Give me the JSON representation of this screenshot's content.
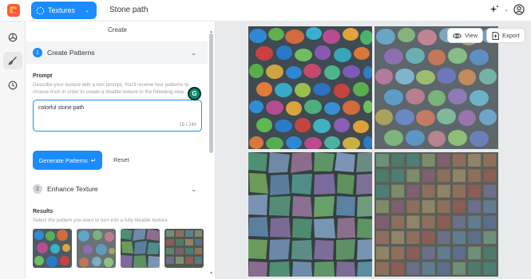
{
  "header": {
    "product_label": "Textures",
    "document_title": "Stone path"
  },
  "panel": {
    "title": "Create",
    "step1": {
      "number": "1",
      "label": "Create Patterns"
    },
    "prompt": {
      "label": "Prompt",
      "helper": "Describe your texture with a text prompt. You'll receive four patterns to choose from in order to create a tileable texture in the following step.",
      "value": "colorful stone path",
      "counter": "19 / 240"
    },
    "generate_label": "Generate Patterns",
    "reset_label": "Reset",
    "step2": {
      "number": "2",
      "label": "Enhance Texture"
    },
    "results": {
      "label": "Results",
      "helper": "Select the pattern you want to turn into a fully tileable texture."
    }
  },
  "canvas": {
    "view_label": "View",
    "export_label": "Export"
  },
  "colors": {
    "accent": "#1a8cff",
    "grammarly": "#0f8a6c"
  }
}
